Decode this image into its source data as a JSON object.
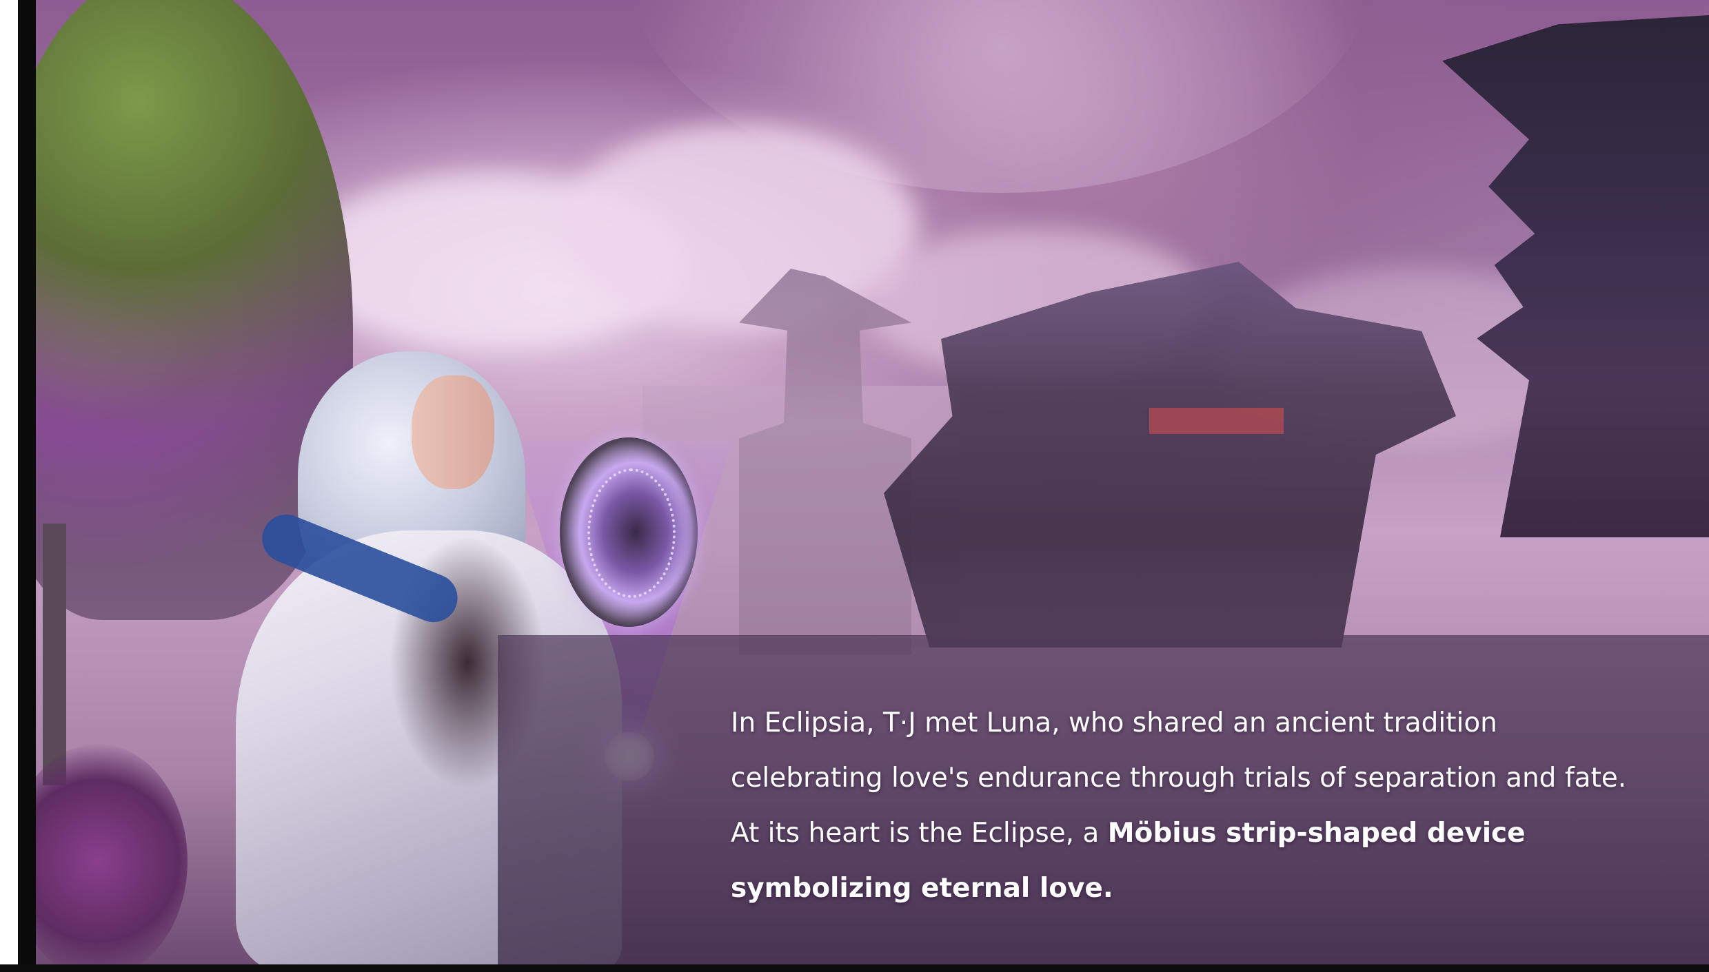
{
  "caption": {
    "lead": "In Eclipsia, T·J met Luna, who shared an ancient tradition celebrating love's endurance through trials of separation and fate. At its heart is the Eclipse, a ",
    "emphasis": "Möbius strip-shaped device symbolizing eternal love."
  },
  "colors": {
    "sky_purple": "#a17aa5",
    "panel_overlay": "#503a5a",
    "text": "#ffffff"
  }
}
